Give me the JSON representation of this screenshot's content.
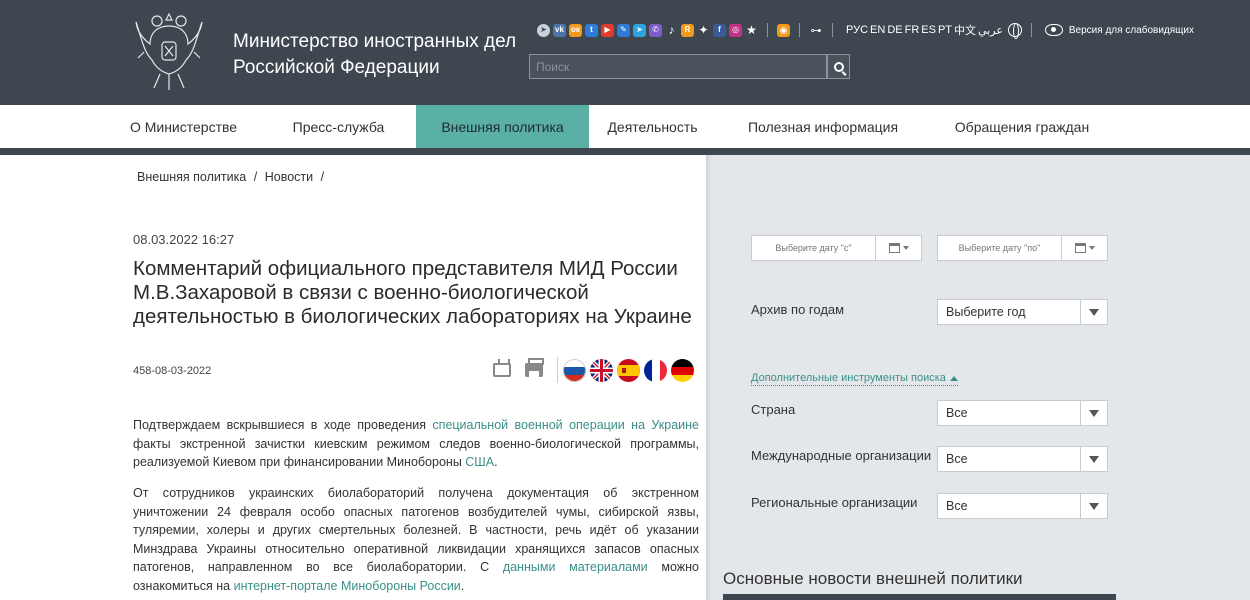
{
  "header": {
    "ministry_line1": "Министерство иностранных дел",
    "ministry_line2": "Российской Федерации",
    "social_icons": [
      "telegram-icon",
      "vk-icon",
      "odnoklassniki-icon",
      "twitter-icon",
      "youtube-icon",
      "livejournal-icon",
      "telegram-icon",
      "viber-icon",
      "tiktok-icon",
      "rutube-icon",
      "plus-icon",
      "facebook-icon",
      "instagram-icon",
      "star-icon"
    ],
    "languages": [
      "РУС",
      "EN",
      "DE",
      "FR",
      "ES",
      "PT",
      "中文",
      "عربي"
    ],
    "accessibility_label": "Версия для слабовидящих",
    "search_placeholder": "Поиск"
  },
  "nav": {
    "items": [
      {
        "label": "О Министерстве",
        "active": false
      },
      {
        "label": "Пресс-служба",
        "active": false
      },
      {
        "label": "Внешняя политика",
        "active": true
      },
      {
        "label": "Деятельность",
        "active": false
      },
      {
        "label": "Полезная информация",
        "active": false
      },
      {
        "label": "Обращения граждан",
        "active": false
      }
    ]
  },
  "breadcrumb": [
    "Внешняя политика",
    "Новости"
  ],
  "breadcrumb_sep": "/",
  "article": {
    "date": "08.03.2022 16:27",
    "title": "Комментарий официального представителя МИД России М.В.Захаровой в связи с военно-биологической деятельностью в биологических лабораториях на Украине",
    "doc_number": "458-08-03-2022",
    "p1_a": "Подтверждаем вскрывшиеся в ходе проведения ",
    "p1_link1": "специальной военной операции на Украине",
    "p1_b": " факты экстренной зачистки киевским режимом следов военно-биологической программы, реализуемой Киевом при финансировании Минобороны ",
    "p1_link2": "США",
    "p1_c": ".",
    "p2_a": "От сотрудников украинских биолабораторий получена документация об экстренном уничтожении 24 февраля особо опасных патогенов возбудителей чумы, сибирской язвы, туляремии, холеры и других смертельных болезней. В частности, речь идёт об указании Минздрава Украины относительно оперативной ликвидации хранящихся запасов опасных патогенов, направленном во все биолаборатории. С ",
    "p2_link1": "данными материалами",
    "p2_b": " можно ознакомиться на ",
    "p2_link2": "интернет-портале Минобороны России",
    "p2_c": "."
  },
  "sidebar": {
    "date_from_placeholder": "Выберите дату \"с\"",
    "date_to_placeholder": "Выберите дату \"по\"",
    "archive_label": "Архив по годам",
    "archive_value": "Выберите год",
    "extra_tools_link": "Дополнительные инструменты поиска",
    "country_label": "Страна",
    "country_value": "Все",
    "intl_orgs_label": "Международные организации",
    "intl_orgs_value": "Все",
    "regional_orgs_label": "Региональные организации",
    "regional_orgs_value": "Все",
    "news_heading": "Основные новости внешней политики"
  },
  "colors": {
    "header_bg": "#3e4750",
    "nav_active": "#5bb0a6",
    "link": "#3a8f88",
    "sidebar_bg": "#e4e7ea"
  }
}
